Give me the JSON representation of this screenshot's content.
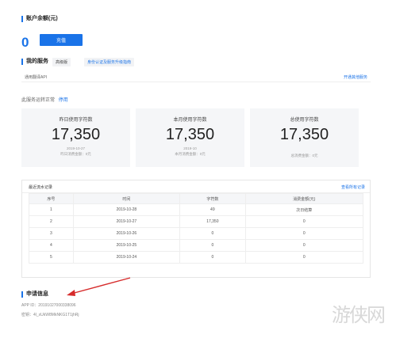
{
  "balance": {
    "title": "账户余额(元)",
    "amount": "0",
    "recharge_label": "充值"
  },
  "services": {
    "title": "我的服务",
    "tag_type": "高级版",
    "tag_link": "身份认证及服务升级指南",
    "service_name": "通用翻译API",
    "service_link": "开通其他服务"
  },
  "status": {
    "text": "此服务运转正常",
    "stop_label": "停用"
  },
  "stats": [
    {
      "label": "昨日使用字符数",
      "value": "17,350",
      "date": "2019-10-27",
      "fee": "昨日消费金额：0元"
    },
    {
      "label": "本月使用字符数",
      "value": "17,350",
      "date": "2019-10",
      "fee": "本月消费金额：0元"
    },
    {
      "label": "总使用字符数",
      "value": "17,350",
      "date": "",
      "fee": "总消费金额：0元"
    }
  ],
  "records": {
    "title": "最近流水记录",
    "view_all": "查看所有记录",
    "headers": [
      "序号",
      "时间",
      "字符数",
      "消费金额(元)"
    ],
    "rows": [
      [
        "1",
        "2019-10-28",
        "49",
        "次日结算"
      ],
      [
        "2",
        "2019-10-27",
        "17,350",
        "0"
      ],
      [
        "3",
        "2019-10-26",
        "0",
        "0"
      ],
      [
        "4",
        "2019-10-25",
        "0",
        "0"
      ],
      [
        "5",
        "2019-10-24",
        "0",
        "0"
      ]
    ]
  },
  "apply": {
    "title": "申请信息",
    "app_id": "APP ID：20191027000338096",
    "key": "密钥：4l_xUkW8MkNKG1T1jhRj"
  },
  "watermark": "游侠网",
  "colors": {
    "accent": "#1a73e8",
    "arrow": "#d62b2b"
  }
}
